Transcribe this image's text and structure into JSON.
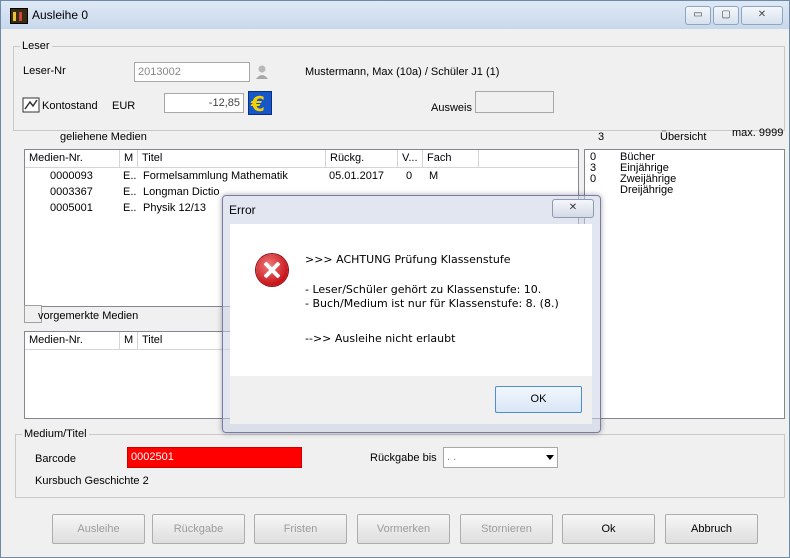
{
  "window": {
    "title": "Ausleihe 0",
    "controls": {
      "minimize": "▭",
      "maximize": "▢",
      "close": "✕"
    }
  },
  "leser": {
    "group_label": "Leser",
    "nr_label": "Leser-Nr",
    "nr_value": "2013002",
    "name": "Mustermann, Max (10a) / Schüler J1 (1)",
    "kontostand_label": "Kontostand",
    "currency": "EUR",
    "balance": "-12,85",
    "ausweis_label": "Ausweis",
    "ausweis_value": ""
  },
  "geliehene": {
    "label": "geliehene Medien",
    "count": "3",
    "columns": [
      "Medien-Nr.",
      "M",
      "Titel",
      "Rückg.",
      "V...",
      "Fach"
    ],
    "rows": [
      {
        "nr": "0000093",
        "m": "E..",
        "titel": "Formelsammlung Mathematik",
        "rueckg": "05.01.2017",
        "v": "0",
        "fach": "M"
      },
      {
        "nr": "0003367",
        "m": "E..",
        "titel": "Longman Dictio",
        "rueckg": "",
        "v": "",
        "fach": ""
      },
      {
        "nr": "0005001",
        "m": "E..",
        "titel": "Physik 12/13",
        "rueckg": "",
        "v": "",
        "fach": ""
      }
    ]
  },
  "uebersicht": {
    "label": "Übersicht",
    "max": "max. 9999",
    "rows": [
      {
        "count": "0",
        "label": "Bücher"
      },
      {
        "count": "3",
        "label": "Einjährige"
      },
      {
        "count": "0",
        "label": "Zweijährige"
      },
      {
        "count": "",
        "label": "Dreijährige"
      }
    ]
  },
  "vorgemerkte": {
    "label": "vorgemerkte Medien",
    "columns": [
      "Medien-Nr.",
      "M",
      "Titel"
    ]
  },
  "medium": {
    "group_label": "Medium/Titel",
    "barcode_label": "Barcode",
    "barcode_value": "0002501",
    "titel": "Kursbuch Geschichte 2",
    "rueckgabe_label": "Rückgabe bis",
    "rueckgabe_value": "  .  .",
    "barcode_bg": "#ff0000"
  },
  "buttons": {
    "ausleihe": "Ausleihe",
    "rueckgabe": "Rückgabe",
    "fristen": "Fristen",
    "vormerken": "Vormerken",
    "stornieren": "Stornieren",
    "ok": "Ok",
    "abbruch": "Abbruch"
  },
  "dialog": {
    "title": "Error",
    "close": "✕",
    "line1": ">>> ACHTUNG Prüfung Klassenstufe",
    "line2": "- Leser/Schüler gehört zu Klassenstufe: 10.",
    "line3": "- Buch/Medium ist nur für Klassenstufe: 8. (8.)",
    "line4": "-->> Ausleihe nicht erlaubt",
    "ok": "OK",
    "icon": "error-icon"
  }
}
